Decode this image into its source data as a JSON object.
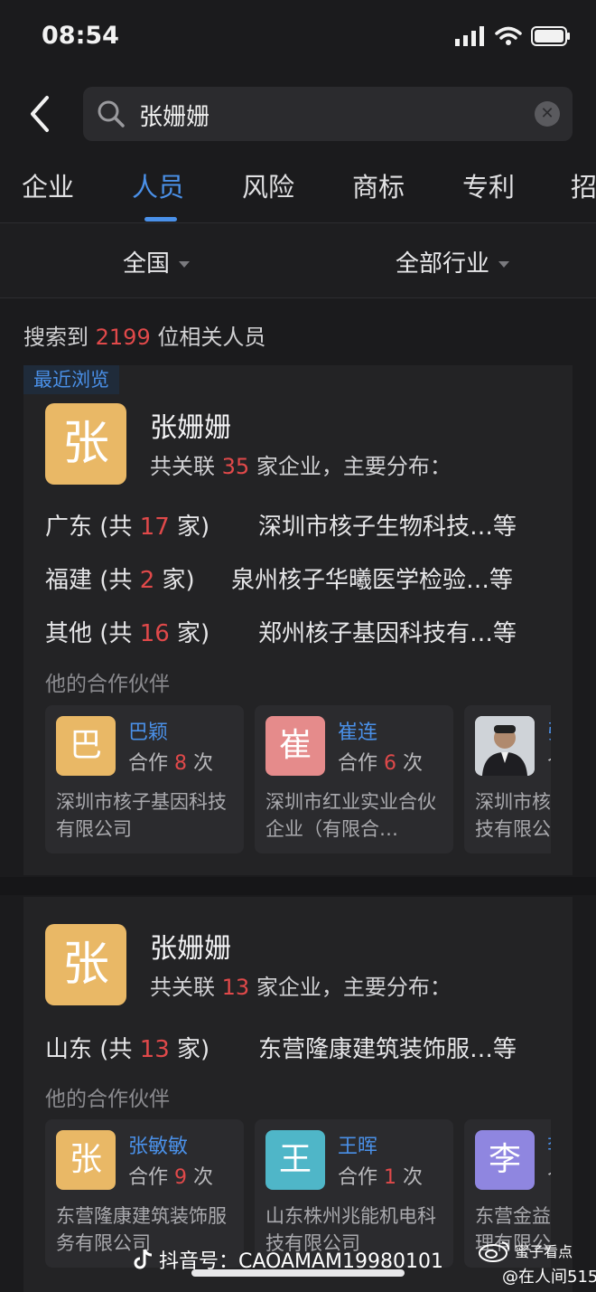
{
  "status": {
    "time": "08:54"
  },
  "search": {
    "value": "张姗姗"
  },
  "tabs": [
    "企业",
    "人员",
    "风险",
    "商标",
    "专利",
    "招"
  ],
  "filters": {
    "region": "全国",
    "industry": "全部行业"
  },
  "results": {
    "prefix": "搜索到 ",
    "count": "2199",
    "suffix": " 位相关人员"
  },
  "cards": [
    {
      "tag": "最近浏览",
      "avatar": "张",
      "name": "张姗姗",
      "assoc_prefix": "共关联 ",
      "assoc_count": "35",
      "assoc_suffix": " 家企业，主要分布：",
      "regions": [
        {
          "prov": "广东",
          "open": " (共 ",
          "count": "17",
          "close": " 家)",
          "company": "深圳市核子生物科技…等"
        },
        {
          "prov": "福建",
          "open": " (共 ",
          "count": "2",
          "close": " 家)",
          "company": "泉州核子华曦医学检验…等"
        },
        {
          "prov": "其他",
          "open": " (共 ",
          "count": "16",
          "close": " 家)",
          "company": "郑州核子基因科技有…等"
        }
      ],
      "partners_title": "他的合作伙伴",
      "partners": [
        {
          "avatar": "巴",
          "name": "巴颖",
          "times_prefix": "合作 ",
          "times": "8",
          "times_suffix": " 次",
          "company": "深圳市核子基因科技有限公司"
        },
        {
          "avatar": "崔",
          "name": "崔连",
          "times_prefix": "合作 ",
          "times": "6",
          "times_suffix": " 次",
          "company": "深圳市红业实业合伙企业（有限合…"
        },
        {
          "avatar": "photo",
          "name": "张",
          "times_prefix": "合",
          "times": "",
          "times_suffix": "",
          "company": "深圳市核技有限公"
        }
      ]
    },
    {
      "avatar": "张",
      "name": "张姗姗",
      "assoc_prefix": "共关联 ",
      "assoc_count": "13",
      "assoc_suffix": " 家企业，主要分布：",
      "regions": [
        {
          "prov": "山东",
          "open": " (共 ",
          "count": "13",
          "close": " 家)",
          "company": "东营隆康建筑装饰服…等"
        }
      ],
      "partners_title": "他的合作伙伴",
      "partners": [
        {
          "avatar": "张",
          "name": "张敏敏",
          "times_prefix": "合作 ",
          "times": "9",
          "times_suffix": " 次",
          "company": "东营隆康建筑装饰服务有限公司"
        },
        {
          "avatar": "王",
          "name": "王晖",
          "times_prefix": "合作 ",
          "times": "1",
          "times_suffix": " 次",
          "company": "山东株州兆能机电科技有限公司"
        },
        {
          "avatar": "李",
          "name": "李",
          "times_prefix": "合",
          "times": "",
          "times_suffix": "",
          "company": "东营金益理有限公"
        }
      ]
    }
  ],
  "colors": {
    "accent": "#4a90e8",
    "highlight": "#e0494a",
    "avatar_gold": "#e9b866",
    "avatar_pink": "#e58b8b",
    "avatar_teal": "#4fb6c8",
    "avatar_purple": "#8f86e0"
  },
  "watermarks": {
    "douyin": "抖音号：CAOAMAM19980101",
    "weibo_handle": "@在人间515",
    "weibo_logo_text": "蜜子看点"
  }
}
